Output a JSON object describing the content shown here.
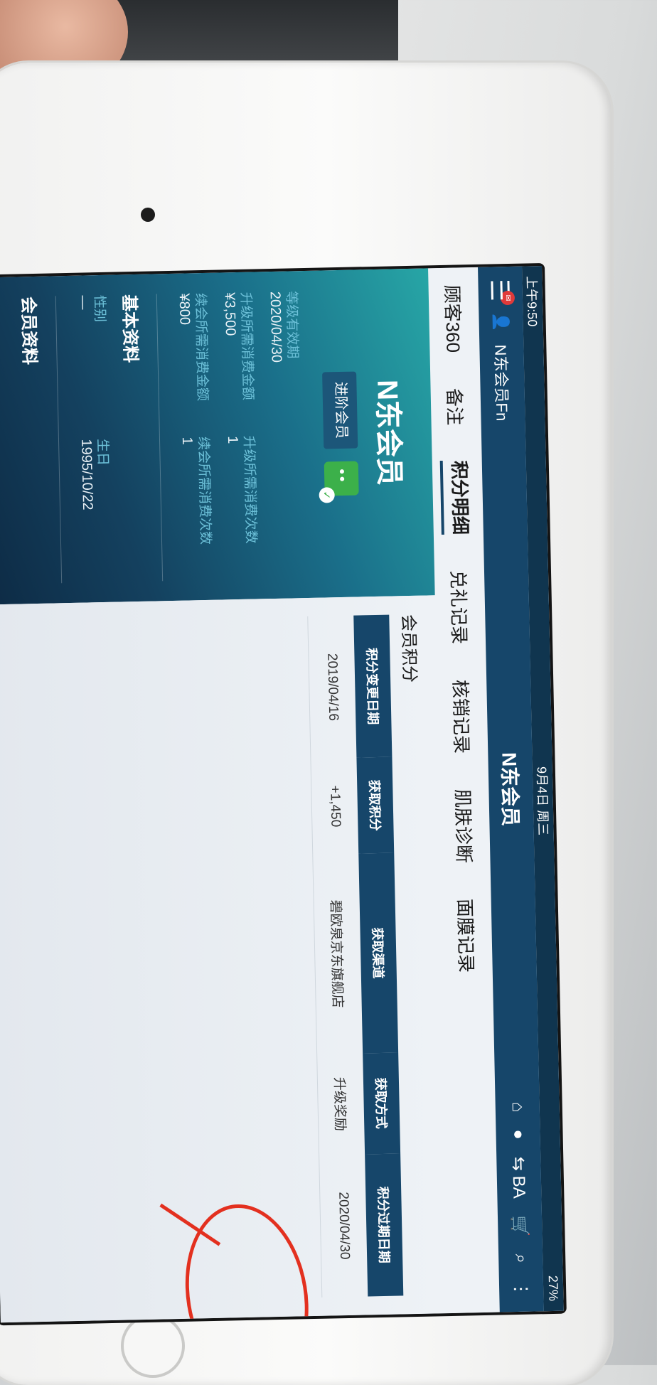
{
  "status": {
    "time": "上午9:50",
    "date": "9月4日 周三",
    "battery": "27%"
  },
  "nav": {
    "user": "N东会员Fn",
    "title": "N东会员",
    "badge": "",
    "right_ba": "BA"
  },
  "tabs": [
    "顾客360",
    "备注",
    "积分明细",
    "兑礼记录",
    "核销记录",
    "肌肤诊断",
    "面膜记录"
  ],
  "member": {
    "card_title": "N东会员",
    "level": "进阶会员",
    "fields": [
      {
        "label": "等级有效期",
        "value": "2020/04/30"
      },
      {
        "label": "",
        "value": ""
      },
      {
        "label": "升级所需消费金额",
        "value": "¥3,500"
      },
      {
        "label": "升级所需消费次数",
        "value": "1"
      },
      {
        "label": "续会所需消费金额",
        "value": "¥800"
      },
      {
        "label": "续会所需消费次数",
        "value": "1"
      }
    ],
    "basic_title": "基本资料",
    "basic": [
      {
        "label": "性别",
        "value": "—"
      },
      {
        "label": "生日",
        "value": "1995/10/22"
      }
    ],
    "profile_title": "会员资料"
  },
  "points": {
    "title": "会员积分",
    "headers": [
      "积分变更日期",
      "获取积分",
      "获取渠道",
      "获取方式",
      "积分过期日期"
    ],
    "rows": [
      [
        "2019/04/16",
        "+1,450",
        "碧欧泉京东旗舰店",
        "升级奖励",
        "2020/04/30"
      ]
    ]
  }
}
